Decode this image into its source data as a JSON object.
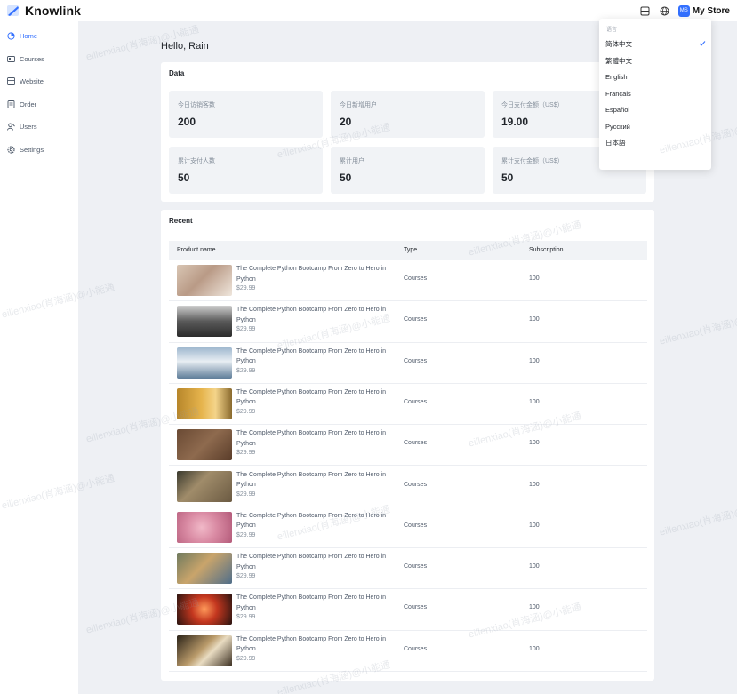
{
  "app": {
    "name": "Knowlink"
  },
  "header": {
    "store_initials": "MS",
    "store_name": "My Store"
  },
  "sidebar": {
    "items": [
      {
        "label": "Home",
        "icon": "home-icon",
        "active": true
      },
      {
        "label": "Courses",
        "icon": "courses-icon",
        "active": false
      },
      {
        "label": "Website",
        "icon": "website-icon",
        "active": false
      },
      {
        "label": "Order",
        "icon": "order-icon",
        "active": false
      },
      {
        "label": "Users",
        "icon": "users-icon",
        "active": false
      },
      {
        "label": "Settings",
        "icon": "settings-icon",
        "active": false
      }
    ]
  },
  "main": {
    "greeting": "Hello, Rain",
    "data_title": "Data",
    "cards": [
      {
        "label": "今日访销客数",
        "value": "200"
      },
      {
        "label": "今日新增用户",
        "value": "20"
      },
      {
        "label": "今日支付金额（US$）",
        "value": "19.00"
      },
      {
        "label": "累计支付人数",
        "value": "50"
      },
      {
        "label": "累计用户",
        "value": "50"
      },
      {
        "label": "累计支付金额（US$）",
        "value": "50"
      }
    ],
    "recent_title": "Recent",
    "table": {
      "headers": [
        "Product name",
        "Type",
        "Subscription"
      ],
      "rows": [
        {
          "name": "The Complete Python Bootcamp From Zero to Hero in Python",
          "price": "$29.99",
          "type": "Courses",
          "subscription": "100"
        },
        {
          "name": "The Complete Python Bootcamp From Zero to Hero in Python",
          "price": "$29.99",
          "type": "Courses",
          "subscription": "100"
        },
        {
          "name": "The Complete Python Bootcamp From Zero to Hero in Python",
          "price": "$29.99",
          "type": "Courses",
          "subscription": "100"
        },
        {
          "name": "The Complete Python Bootcamp From Zero to Hero in Python",
          "price": "$29.99",
          "type": "Courses",
          "subscription": "100"
        },
        {
          "name": "The Complete Python Bootcamp From Zero to Hero in Python",
          "price": "$29.99",
          "type": "Courses",
          "subscription": "100"
        },
        {
          "name": "The Complete Python Bootcamp From Zero to Hero in Python",
          "price": "$29.99",
          "type": "Courses",
          "subscription": "100"
        },
        {
          "name": "The Complete Python Bootcamp From Zero to Hero in Python",
          "price": "$29.99",
          "type": "Courses",
          "subscription": "100"
        },
        {
          "name": "The Complete Python Bootcamp From Zero to Hero in Python",
          "price": "$29.99",
          "type": "Courses",
          "subscription": "100"
        },
        {
          "name": "The Complete Python Bootcamp From Zero to Hero in Python",
          "price": "$29.99",
          "type": "Courses",
          "subscription": "100"
        },
        {
          "name": "The Complete Python Bootcamp From Zero to Hero in Python",
          "price": "$29.99",
          "type": "Courses",
          "subscription": "100"
        }
      ]
    }
  },
  "language_menu": {
    "title": "语言",
    "options": [
      "简体中文",
      "繁體中文",
      "English",
      "Français",
      "Español",
      "Русский",
      "日本語"
    ],
    "selected": "简体中文"
  },
  "watermark": "eillenxiao(肖海涵)@小能通",
  "colors": {
    "accent": "#3370ff",
    "background": "#eef0f4",
    "card": "#f1f3f6"
  }
}
